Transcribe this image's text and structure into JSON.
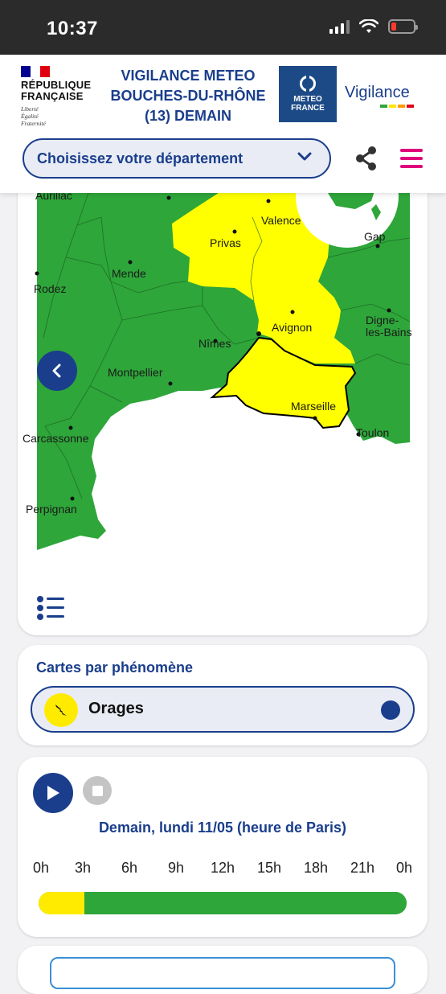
{
  "status": {
    "time": "10:37"
  },
  "header": {
    "republic_line1": "RÉPUBLIQUE",
    "republic_line2": "FRANÇAISE",
    "motto1": "Liberté",
    "motto2": "Égalité",
    "motto3": "Fraternité",
    "title_line1": "VIGILANCE METEO",
    "title_line2": "BOUCHES-DU-RHÔNE",
    "title_line3": "(13) DEMAIN",
    "mf_line1": "METEO",
    "mf_line2": "FRANCE",
    "vigilance_brand": "Vigilance",
    "department_select": "Choisissez votre département"
  },
  "map": {
    "cities": [
      "Aurillac",
      "Valence",
      "Privas",
      "Gap",
      "Mende",
      "Rodez",
      "Avignon",
      "Digne-",
      "les-Bains",
      "Nîmes",
      "Montpellier",
      "Marseille",
      "Toulon",
      "Carcassonne",
      "Perpignan"
    ],
    "colors": {
      "green": "#2ea63a",
      "yellow": "#ffff00"
    }
  },
  "phenomena": {
    "title": "Cartes par phénomène",
    "selected": "Orages"
  },
  "timeline": {
    "date_label": "Demain, lundi 11/05 (heure de Paris)",
    "hours": [
      "0h",
      "3h",
      "6h",
      "9h",
      "12h",
      "15h",
      "18h",
      "21h",
      "0h"
    ],
    "segments": [
      {
        "level": "jaune",
        "color": "#ffeb00",
        "from_hour": 0,
        "to_hour": 3
      },
      {
        "level": "vert",
        "color": "#2ea63a",
        "from_hour": 3,
        "to_hour": 24
      }
    ]
  }
}
